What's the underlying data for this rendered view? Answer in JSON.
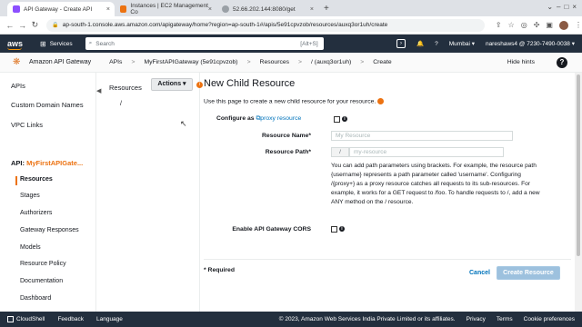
{
  "browser": {
    "tabs": [
      {
        "label": "API Gateway - Create API",
        "active": true
      },
      {
        "label": "Instances | EC2 Management Co",
        "active": false
      },
      {
        "label": "52.66.202.144:8080/get",
        "active": false
      }
    ],
    "url": "ap-south-1.console.aws.amazon.com/apigateway/home?region=ap-south-1#/apis/5e91cpvzob/resources/auxq3or1uh/create"
  },
  "aws": {
    "logo": "aws",
    "services_label": "Services",
    "search_placeholder": "Search",
    "search_shortcut": "[Alt+S]",
    "region": "Mumbai ▾",
    "account": "nareshaws4 @ 7230-7490-0038 ▾"
  },
  "service_bar": {
    "service_name": "Amazon API Gateway",
    "breadcrumbs": [
      "APIs",
      ">",
      "MyFirstAPIGateway (5e91cpvzob)",
      ">",
      "Resources",
      ">",
      "/ (auxq3or1uh)",
      ">",
      "Create"
    ],
    "hide_hints": "Hide hints"
  },
  "left_nav": {
    "top_items": [
      "APIs",
      "Custom Domain Names",
      "VPC Links"
    ],
    "api_prefix": "API:",
    "api_name": "MyFirstAPIGate...",
    "sub_items": [
      "Resources",
      "Stages",
      "Authorizers",
      "Gateway Responses",
      "Models",
      "Resource Policy",
      "Documentation",
      "Dashboard"
    ],
    "selected": "Resources"
  },
  "resources_panel": {
    "heading": "Resources",
    "actions_label": "Actions ▾",
    "root": "/"
  },
  "form": {
    "title": "New Child Resource",
    "intro": "Use this page to create a new child resource for your resource.",
    "proxy_label_prefix": "Configure as",
    "proxy_link": "proxy resource",
    "name_label": "Resource Name*",
    "name_placeholder": "My Resource",
    "path_label": "Resource Path*",
    "path_prefix": "/",
    "path_placeholder": "my-resource",
    "help_text": [
      "You can add path parameters using brackets. For example, the resource path",
      "{username} represents a path parameter called 'username'. Configuring",
      "/{proxy+} as a proxy resource catches all requests to its sub-resources. For",
      "example, it works for a GET request to /foo. To handle requests to /, add a new",
      "ANY method on the / resource."
    ],
    "cors_label": "Enable API Gateway CORS",
    "required_note": "* Required",
    "cancel_label": "Cancel",
    "create_label": "Create Resource"
  },
  "footer": {
    "cloudshell": "CloudShell",
    "feedback": "Feedback",
    "language": "Language",
    "copyright": "© 2023, Amazon Web Services India Private Limited or its affiliates.",
    "privacy": "Privacy",
    "terms": "Terms",
    "cookies": "Cookie preferences"
  }
}
